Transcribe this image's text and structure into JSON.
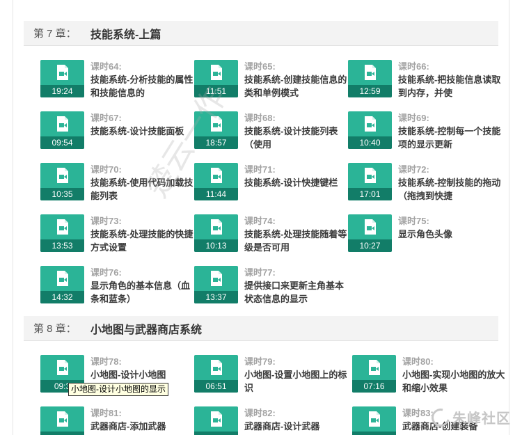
{
  "chapters": [
    {
      "number": "第 7 章：",
      "title": "技能系统-上篇"
    },
    {
      "number": "第 8 章：",
      "title": "小地图与武器商店系统"
    }
  ],
  "lessons": [
    {
      "no": "课时64:",
      "title": "技能系统-分析技能的属性和技能信息的",
      "duration": "19:24"
    },
    {
      "no": "课时65:",
      "title": "技能系统-创建技能信息的类和单例模式",
      "duration": "11:51"
    },
    {
      "no": "课时66:",
      "title": "技能系统-把技能信息读取到内存，并使",
      "duration": "12:59"
    },
    {
      "no": "课时67:",
      "title": "技能系统-设计技能面板",
      "duration": "09:54"
    },
    {
      "no": "课时68:",
      "title": "技能系统-设计技能列表（使用",
      "duration": "18:57"
    },
    {
      "no": "课时69:",
      "title": "技能系统-控制每一个技能项的显示更新",
      "duration": "10:40"
    },
    {
      "no": "课时70:",
      "title": "技能系统-使用代码加载技能列表",
      "duration": "10:35"
    },
    {
      "no": "课时71:",
      "title": "技能系统-设计快捷键栏",
      "duration": "11:44"
    },
    {
      "no": "课时72:",
      "title": "技能系统-控制技能的拖动（拖拽到快捷",
      "duration": "17:01"
    },
    {
      "no": "课时73:",
      "title": "技能系统-处理技能的快捷方式设置",
      "duration": "13:53"
    },
    {
      "no": "课时74:",
      "title": "技能系统-处理技能随着等级是否可用",
      "duration": "10:13"
    },
    {
      "no": "课时75:",
      "title": "显示角色头像",
      "duration": "10:27"
    },
    {
      "no": "课时76:",
      "title": "显示角色的基本信息（血条和蓝条）",
      "duration": "14:32"
    },
    {
      "no": "课时77:",
      "title": "提供接口来更新主角基本状态信息的显示",
      "duration": "13:37"
    },
    {
      "no": "课时78:",
      "title": "小地图-设计小地图",
      "duration": "09:3"
    },
    {
      "no": "课时79:",
      "title": "小地图-设置小地图上的标识",
      "duration": "06:51"
    },
    {
      "no": "课时80:",
      "title": "小地图-实现小地图的放大和缩小效果",
      "duration": "07:16"
    },
    {
      "no": "课时81:",
      "title": "武器商店-添加武器",
      "duration": ""
    },
    {
      "no": "课时82:",
      "title": "武器商店-设计武器",
      "duration": ""
    },
    {
      "no": "课时83:",
      "title": "武器商店-创建装备",
      "duration": ""
    }
  ],
  "tooltip": "小地图-设计小地图的显示",
  "watermark": "楚云一作",
  "logo_text": "朱峰社区",
  "icon": "video-file-icon",
  "colors": {
    "thumb": "#2bb497",
    "duration_bar": "#127d68",
    "lesson_no": "#a3a3a3"
  }
}
